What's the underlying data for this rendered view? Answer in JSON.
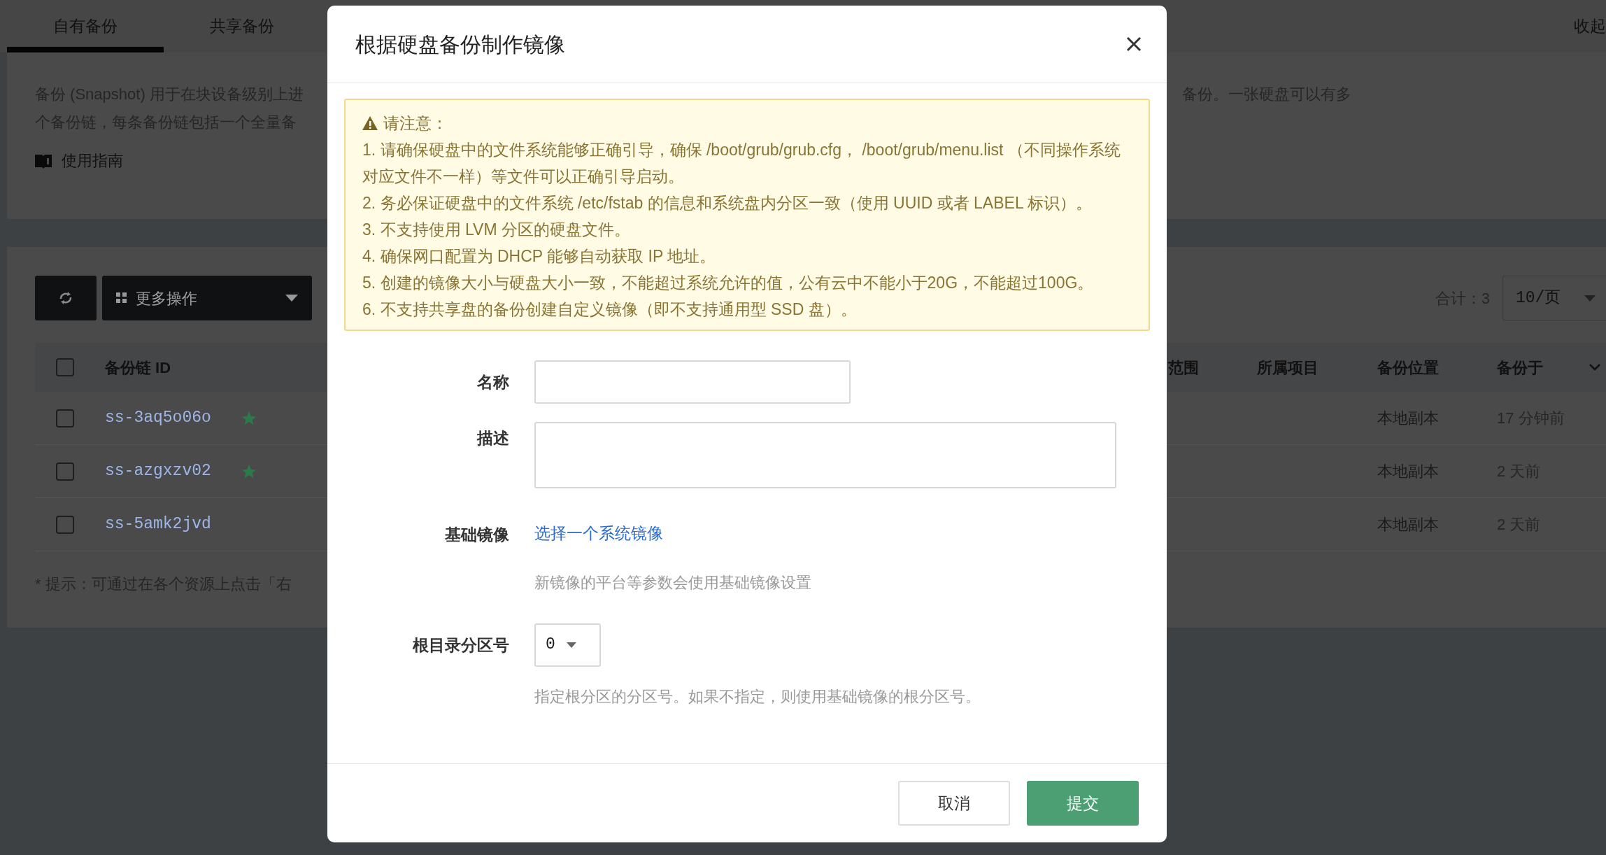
{
  "tabs": [
    {
      "label": "自有备份",
      "selected": true
    },
    {
      "label": "共享备份",
      "selected": false
    }
  ],
  "collapse_link": "收起",
  "intro": {
    "left_lines": [
      "备份 (Snapshot) 用于在块设备级别上进",
      "个备份链，每条备份链包括一个全量备"
    ],
    "right_lines": [
      "备份。一张硬盘可以有多"
    ],
    "guide_link": "使用指南"
  },
  "toolbar": {
    "more_actions": "更多操作",
    "total": "合计：3",
    "page_size": "10/页"
  },
  "table": {
    "select_all_checked": false,
    "columns": [
      "备份链 ID",
      "范围",
      "所属项目",
      "备份位置",
      "备份于"
    ],
    "rows": [
      {
        "checked": false,
        "id": "ss-3aq5o06o",
        "starred": true,
        "location": "本地副本",
        "time": "17 分钟前"
      },
      {
        "checked": false,
        "id": "ss-azgxzv02",
        "starred": true,
        "location": "本地副本",
        "time": "2 天前"
      },
      {
        "checked": false,
        "id": "ss-5amk2jvd",
        "starred": false,
        "location": "本地副本",
        "time": "2 天前"
      }
    ]
  },
  "tip": "* 提示：可通过在各个资源上点击「右",
  "dialog": {
    "title": "根据硬盘备份制作镜像",
    "notice": {
      "heading": "请注意：",
      "items": [
        "1. 请确保硬盘中的文件系统能够正确引导，确保 /boot/grub/grub.cfg， /boot/grub/menu.list （不同操作系统对应文件不一样）等文件可以正确引导启动。",
        "2. 务必保证硬盘中的文件系统 /etc/fstab 的信息和系统盘内分区一致（使用 UUID 或者 LABEL 标识）。",
        "3. 不支持使用 LVM 分区的硬盘文件。",
        "4. 确保网口配置为 DHCP 能够自动获取 IP 地址。",
        "5. 创建的镜像大小与硬盘大小一致，不能超过系统允许的值，公有云中不能小于20G，不能超过100G。",
        "6. 不支持共享盘的备份创建自定义镜像（即不支持通用型 SSD 盘）。"
      ]
    },
    "fields": [
      {
        "kind": "input",
        "label": "名称"
      },
      {
        "kind": "textarea",
        "label": "描述"
      },
      {
        "kind": "link",
        "label": "基础镜像",
        "link": "选择一个系统镜像",
        "hint": "新镜像的平台等参数会使用基础镜像设置"
      },
      {
        "kind": "select",
        "label": "根目录分区号",
        "value": "0",
        "hint": "指定根分区的分区号。如果不指定，则使用基础镜像的根分区号。"
      }
    ],
    "buttons": [
      {
        "kind": "secondary",
        "label": "取消"
      },
      {
        "kind": "primary",
        "label": "提交"
      }
    ]
  }
}
